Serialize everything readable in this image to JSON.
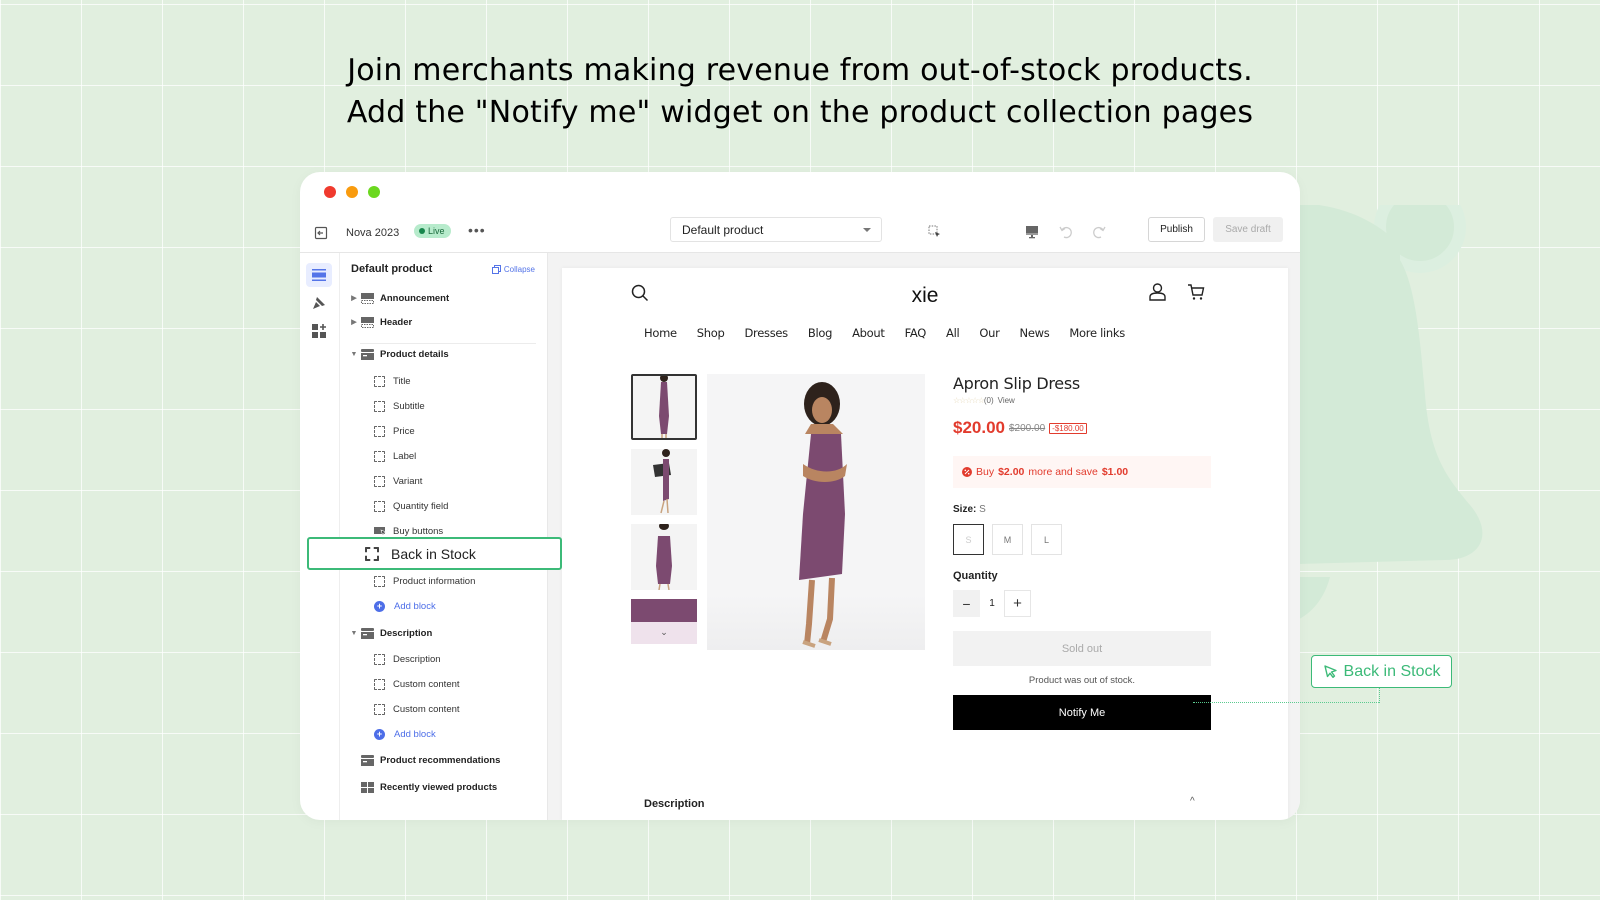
{
  "headline": {
    "line1": "Join merchants making revenue from out-of-stock products.",
    "line2": "Add the \"Notify me\"  widget on the product collection pages"
  },
  "colors": {
    "background": "#e1efdf",
    "accent_green": "#3cba78",
    "price_red": "#e23b2d",
    "link_blue": "#4d6ee8",
    "traffic_red": "#f03a2e",
    "traffic_yellow": "#f99b0e",
    "traffic_green": "#6bd81f"
  },
  "editor": {
    "store_name": "Nova 2023",
    "status_badge": "Live",
    "more_label": "•••",
    "template_select": "Default product",
    "publish_label": "Publish",
    "save_draft_label": "Save draft",
    "icons": [
      "exit-icon",
      "inspect-icon",
      "desktop-icon",
      "undo-icon",
      "redo-icon"
    ]
  },
  "sidebar": {
    "title": "Default product",
    "collapse_label": "Collapse",
    "sections": [
      {
        "label": "Announcement",
        "expanded": false
      },
      {
        "label": "Header",
        "expanded": false
      },
      {
        "label": "Product details",
        "expanded": true,
        "blocks": [
          "Title",
          "Subtitle",
          "Price",
          "Label",
          "Variant",
          "Quantity field",
          "Buy buttons",
          "Back in Stock",
          "Product information"
        ],
        "add_label": "Add block"
      },
      {
        "label": "Description",
        "expanded": true,
        "blocks": [
          "Description",
          "Custom content",
          "Custom content"
        ],
        "add_label": "Add block"
      },
      {
        "label": "Product recommendations"
      },
      {
        "label": "Recently viewed products"
      }
    ],
    "highlighted_block": "Back in Stock"
  },
  "store": {
    "logo": "xie",
    "nav": [
      "Home",
      "Shop",
      "Dresses",
      "Blog",
      "About",
      "FAQ",
      "All",
      "Our",
      "News",
      "More links"
    ],
    "product": {
      "title": "Apron Slip Dress",
      "stars": "☆☆☆☆☆",
      "review_count": "(0)",
      "view_label": "View",
      "price": "$20.00",
      "compare_price": "$200.00",
      "discount": "-$180.00",
      "promo_prefix": "Buy",
      "promo_amount": "$2.00",
      "promo_middle": "more and save",
      "promo_save": "$1.00",
      "size_label": "Size:",
      "size_selected": "S",
      "sizes": [
        "S",
        "M",
        "L"
      ],
      "quantity_label": "Quantity",
      "quantity": "1",
      "sold_out_label": "Sold out",
      "out_of_stock_note": "Product was out of stock.",
      "notify_label": "Notify Me",
      "description_heading": "Description"
    }
  },
  "callout": {
    "label": "Back in Stock"
  }
}
